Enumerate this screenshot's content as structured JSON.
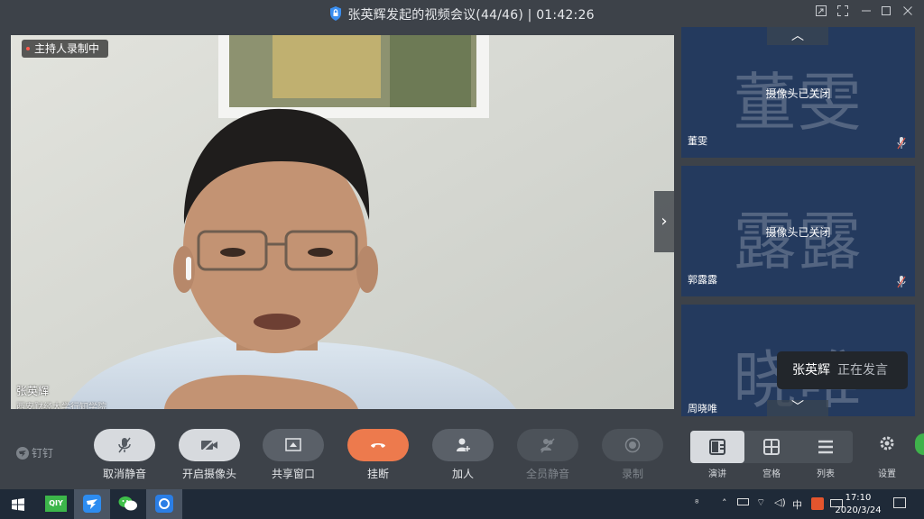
{
  "window": {
    "title": "张英辉发起的视频会议(44/46) | 01:42:26"
  },
  "main_video": {
    "recording_badge": "主持人录制中",
    "speaker_name": "张英辉",
    "speaker_subtitle": "西安财经大学行知学院"
  },
  "participants": [
    {
      "avatar_text": "董雯",
      "camera_status": "摄像头已关闭",
      "name": "董雯"
    },
    {
      "avatar_text": "露露",
      "camera_status": "摄像头已关闭",
      "name": "郭露露"
    },
    {
      "avatar_text": "晓唯",
      "camera_status": "摄",
      "name": "周晓唯"
    }
  ],
  "speaking_toast": {
    "name": "张英辉",
    "status": "正在发言"
  },
  "toolbar": {
    "brand": "钉钉",
    "buttons": [
      {
        "label": "取消静音",
        "icon": "mic-muted-icon"
      },
      {
        "label": "开启摄像头",
        "icon": "camera-off-icon"
      },
      {
        "label": "共享窗口",
        "icon": "share-window-icon"
      },
      {
        "label": "挂断",
        "icon": "hang-up-icon"
      },
      {
        "label": "加人",
        "icon": "add-person-icon"
      },
      {
        "label": "全员静音",
        "icon": "mute-all-icon"
      },
      {
        "label": "录制",
        "icon": "record-icon"
      }
    ],
    "views": [
      {
        "label": "演讲",
        "icon": "speaker-view-icon"
      },
      {
        "label": "宫格",
        "icon": "grid-view-icon"
      },
      {
        "label": "列表",
        "icon": "list-view-icon"
      }
    ],
    "settings_label": "设置"
  },
  "taskbar": {
    "clock_time": "17:10",
    "clock_date": "2020/3/24",
    "ime": "中",
    "accent": "#1f2a38"
  },
  "colors": {
    "hangup": "#ed7a4d",
    "tile_bg": "#243a5e",
    "toolbar_bg": "#3d4249"
  }
}
